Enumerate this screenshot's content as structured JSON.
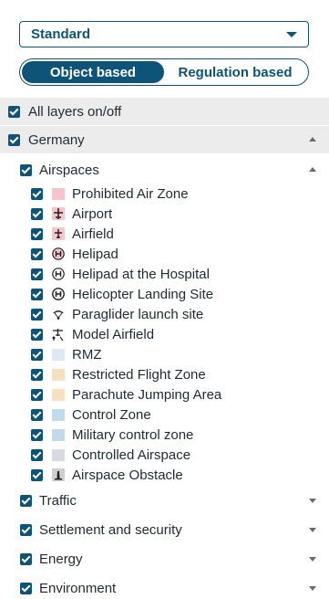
{
  "select": {
    "value": "Standard",
    "icon": "chevron-down-icon"
  },
  "toggle": {
    "left": "Object based",
    "right": "Regulation based"
  },
  "all_layers": {
    "label": "All layers on/off"
  },
  "germany": {
    "label": "Germany"
  },
  "airspaces": {
    "label": "Airspaces"
  },
  "layers": [
    {
      "label": "Prohibited Air Zone",
      "icon": "color-swatch",
      "color": "#f6c4cb"
    },
    {
      "label": "Airport",
      "icon": "airplane-icon",
      "color": "#f6c4cb"
    },
    {
      "label": "Airfield",
      "icon": "small-airplane-icon",
      "color": "#f6c4cb"
    },
    {
      "label": "Helipad",
      "icon": "helipad-icon",
      "color": "#f6c4cb"
    },
    {
      "label": "Helipad at the Hospital",
      "icon": "hospital-helipad-icon",
      "color": "#ffffff"
    },
    {
      "label": "Helicopter Landing Site",
      "icon": "helicopter-landing-icon",
      "color": "#ffffff"
    },
    {
      "label": "Paraglider launch site",
      "icon": "paraglider-icon",
      "color": "#ffffff"
    },
    {
      "label": "Model Airfield",
      "icon": "model-airfield-icon",
      "color": "#ffffff"
    },
    {
      "label": "RMZ",
      "icon": "color-swatch",
      "color": "#dce9f5"
    },
    {
      "label": "Restricted Flight Zone",
      "icon": "color-swatch",
      "color": "#f8e0bf"
    },
    {
      "label": "Parachute Jumping Area",
      "icon": "color-swatch",
      "color": "#f8e0bf"
    },
    {
      "label": "Control Zone",
      "icon": "color-swatch",
      "color": "#c0dcec"
    },
    {
      "label": "Military control zone",
      "icon": "color-swatch",
      "color": "#c0dcec"
    },
    {
      "label": "Controlled Airspace",
      "icon": "color-swatch",
      "color": "#d9d9e3"
    },
    {
      "label": "Airspace Obstacle",
      "icon": "obstacle-icon",
      "color": "#cfcfcf"
    }
  ],
  "groups": [
    {
      "label": "Traffic"
    },
    {
      "label": "Settlement and security"
    },
    {
      "label": "Energy"
    },
    {
      "label": "Environment"
    }
  ],
  "colors": {
    "accent": "#0d5478",
    "band": "#ececec"
  }
}
